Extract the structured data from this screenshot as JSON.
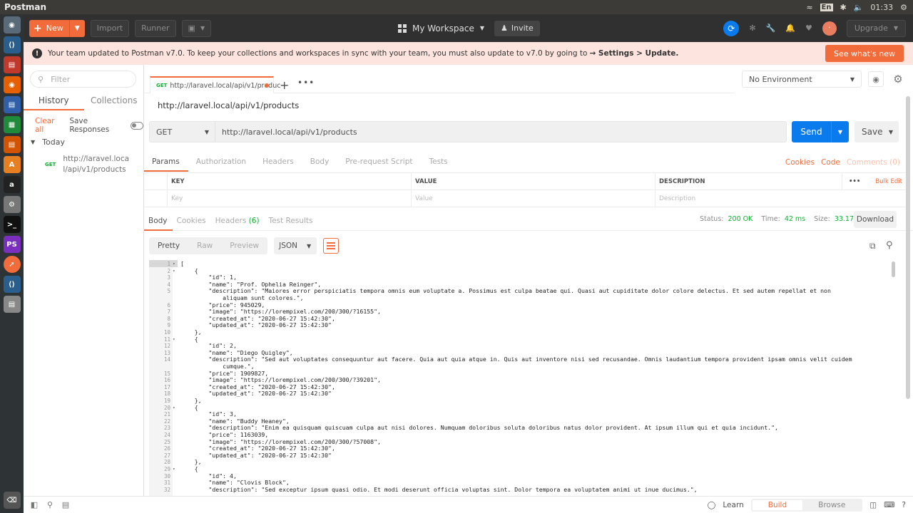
{
  "os": {
    "app_title": "Postman",
    "lang": "En",
    "time": "01:33"
  },
  "header": {
    "new_label": "New",
    "import_label": "Import",
    "runner_label": "Runner",
    "workspace_label": "My Workspace",
    "invite_label": "Invite",
    "upgrade_label": "Upgrade",
    "avatar_initial": "·"
  },
  "banner": {
    "message": "Your team updated to Postman v7.0. To keep your collections and workspaces in sync with your team, you must also update to v7.0 by going to",
    "path": "→ Settings > Update.",
    "cta": "See what's new"
  },
  "sidebar": {
    "filter_placeholder": "Filter",
    "tab_history": "History",
    "tab_collections": "Collections",
    "clear_all": "Clear all",
    "save_responses": "Save Responses",
    "group_today": "Today",
    "history_method": "GET",
    "history_url": "http://laravel.local/api/v1/products"
  },
  "request": {
    "tab_method": "GET",
    "tab_url": "http://laravel.local/api/v1/produc",
    "name": "http://laravel.local/api/v1/products",
    "method": "GET",
    "url": "http://laravel.local/api/v1/products",
    "send": "Send",
    "save": "Save",
    "environment": "No Environment",
    "tabs": [
      "Params",
      "Authorization",
      "Headers",
      "Body",
      "Pre-request Script",
      "Tests"
    ],
    "links": {
      "cookies": "Cookies",
      "code": "Code",
      "comments": "Comments (0)"
    },
    "params_headers": {
      "key": "KEY",
      "value": "VALUE",
      "description": "DESCRIPTION",
      "bulk_edit": "Bulk Edit"
    },
    "params_placeholders": {
      "key": "Key",
      "value": "Value",
      "description": "Description"
    }
  },
  "response": {
    "tabs": {
      "body": "Body",
      "cookies": "Cookies",
      "headers": "Headers",
      "headers_count": "(6)",
      "tests": "Test Results"
    },
    "status_label": "Status:",
    "status_value": "200 OK",
    "time_label": "Time:",
    "time_value": "42 ms",
    "size_label": "Size:",
    "size_value": "33.17 KB",
    "download": "Download",
    "format_buttons": [
      "Pretty",
      "Raw",
      "Preview"
    ],
    "format": "JSON",
    "lines": [
      {
        "n": "1",
        "f": "▾",
        "t": "["
      },
      {
        "n": "2",
        "f": "▾",
        "t": "    {"
      },
      {
        "n": "3",
        "f": "",
        "t": "        \"id\": 1,"
      },
      {
        "n": "4",
        "f": "",
        "t": "        \"name\": \"Prof. Ophelia Reinger\","
      },
      {
        "n": "5",
        "f": "",
        "t": "        \"description\": \"Maiores error perspiciatis tempora omnis eum voluptate a. Possimus est culpa beatae qui. Quasi aut cupiditate dolor colore delectus. Et sed autem repellat et non"
      },
      {
        "n": "",
        "f": "",
        "t": "            aliquam sunt colores.\","
      },
      {
        "n": "6",
        "f": "",
        "t": "        \"price\": 945029,"
      },
      {
        "n": "7",
        "f": "",
        "t": "        \"image\": \"https://lorempixel.com/200/300/?16155\","
      },
      {
        "n": "8",
        "f": "",
        "t": "        \"created_at\": \"2020-06-27 15:42:30\","
      },
      {
        "n": "9",
        "f": "",
        "t": "        \"updated_at\": \"2020-06-27 15:42:30\""
      },
      {
        "n": "10",
        "f": "",
        "t": "    },"
      },
      {
        "n": "11",
        "f": "▾",
        "t": "    {"
      },
      {
        "n": "12",
        "f": "",
        "t": "        \"id\": 2,"
      },
      {
        "n": "13",
        "f": "",
        "t": "        \"name\": \"Diego Quigley\","
      },
      {
        "n": "14",
        "f": "",
        "t": "        \"description\": \"Sed aut voluptates consequuntur aut facere. Quia aut quia atque in. Quis aut inventore nisi sed recusandae. Omnis laudantium tempora provident ipsam omnis velit cuidem"
      },
      {
        "n": "",
        "f": "",
        "t": "            cumque.\","
      },
      {
        "n": "15",
        "f": "",
        "t": "        \"price\": 1909827,"
      },
      {
        "n": "16",
        "f": "",
        "t": "        \"image\": \"https://lorempixel.com/200/300/?39201\","
      },
      {
        "n": "17",
        "f": "",
        "t": "        \"created_at\": \"2020-06-27 15:42:30\","
      },
      {
        "n": "18",
        "f": "",
        "t": "        \"updated_at\": \"2020-06-27 15:42:30\""
      },
      {
        "n": "19",
        "f": "",
        "t": "    },"
      },
      {
        "n": "20",
        "f": "▾",
        "t": "    {"
      },
      {
        "n": "21",
        "f": "",
        "t": "        \"id\": 3,"
      },
      {
        "n": "22",
        "f": "",
        "t": "        \"name\": \"Buddy Heaney\","
      },
      {
        "n": "23",
        "f": "",
        "t": "        \"description\": \"Enim ea quisquam quiscuam culpa aut nisi dolores. Numquam doloribus soluta doloribus natus dolor provident. At ipsum illum qui et quia incidunt.\","
      },
      {
        "n": "24",
        "f": "",
        "t": "        \"price\": 1163039,"
      },
      {
        "n": "25",
        "f": "",
        "t": "        \"image\": \"https://lorempixel.com/200/300/?57008\","
      },
      {
        "n": "26",
        "f": "",
        "t": "        \"created_at\": \"2020-06-27 15:42:30\","
      },
      {
        "n": "27",
        "f": "",
        "t": "        \"updated_at\": \"2020-06-27 15:42:30\""
      },
      {
        "n": "28",
        "f": "",
        "t": "    },"
      },
      {
        "n": "29",
        "f": "▾",
        "t": "    {"
      },
      {
        "n": "30",
        "f": "",
        "t": "        \"id\": 4,"
      },
      {
        "n": "31",
        "f": "",
        "t": "        \"name\": \"Clovis Block\","
      },
      {
        "n": "32",
        "f": "",
        "t": "        \"description\": \"Sed exceptur ipsum quasi odio. Et modi deserunt officia voluptas sint. Dolor tempora ea voluptatem animi ut inue ducimus.\","
      }
    ]
  },
  "bottom": {
    "learn": "Learn",
    "build": "Build",
    "browse": "Browse"
  }
}
